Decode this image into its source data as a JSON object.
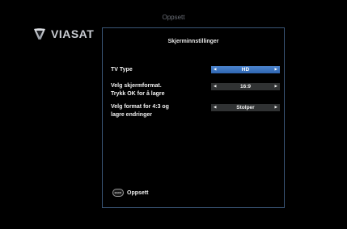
{
  "page_title": "Oppsett",
  "logo": {
    "text": "VIASAT"
  },
  "panel": {
    "title": "Skjerminnstillinger",
    "settings": [
      {
        "label_lines": [
          "TV Type"
        ],
        "value": "HD",
        "state": "active"
      },
      {
        "label_lines": [
          "Velg skjermformat.",
          "Trykk OK for å lagre"
        ],
        "value": "16:9",
        "state": "inactive"
      },
      {
        "label_lines": [
          "Velg format for 4:3 og",
          "lagre endringer"
        ],
        "value": "Stolper",
        "state": "inactive"
      }
    ],
    "footer": {
      "back_icon_text": "BACK",
      "label": "Oppsett"
    }
  },
  "icons": {
    "left_arrow": "arrow-left-icon",
    "right_arrow": "arrow-right-icon"
  },
  "colors": {
    "active_selector": "#3c76c2",
    "inactive_selector": "#303233",
    "panel_border": "#3a5677",
    "background": "#000000"
  }
}
